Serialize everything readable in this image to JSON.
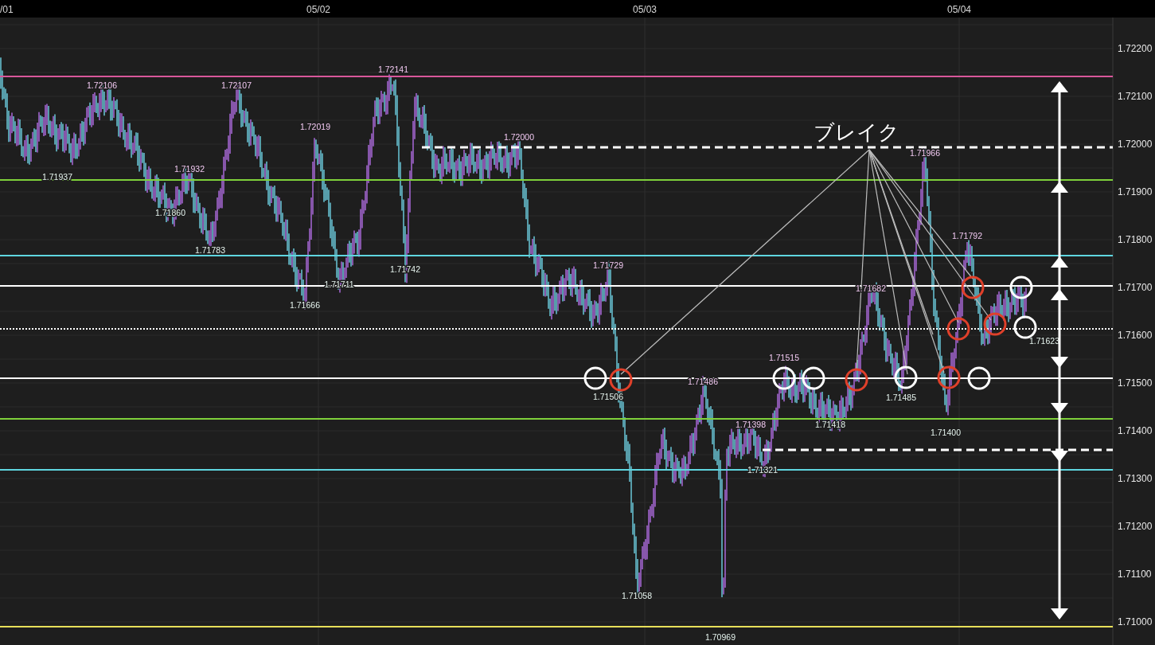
{
  "date_labels": [
    "/01",
    "05/02",
    "05/03",
    "05/04"
  ],
  "price_axis": [
    "1.72200",
    "1.72100",
    "1.72000",
    "1.71900",
    "1.71800",
    "1.71700",
    "1.71600",
    "1.71500",
    "1.71400",
    "1.71300",
    "1.71200",
    "1.71100",
    "1.71000"
  ],
  "level_lines": [
    {
      "kind": "solid",
      "color": "#d9579b"
    },
    {
      "kind": "solid",
      "color": "#7fd13b"
    },
    {
      "kind": "solid",
      "color": "#5fd6e0"
    },
    {
      "kind": "solid",
      "color": "#ffffff"
    },
    {
      "kind": "dotted",
      "color": "#ffffff"
    },
    {
      "kind": "solid",
      "color": "#ffffff"
    },
    {
      "kind": "solid",
      "color": "#7fd13b"
    },
    {
      "kind": "solid",
      "color": "#5fd6e0"
    },
    {
      "kind": "solid",
      "color": "#e8e05a"
    },
    {
      "kind": "dashed",
      "color": "#ffffff"
    },
    {
      "kind": "dashed",
      "color": "#ffffff"
    }
  ],
  "price_labels": [
    {
      "text": "1.72106",
      "kind": "high"
    },
    {
      "text": "1.71937",
      "kind": "low"
    },
    {
      "text": "1.71932",
      "kind": "high"
    },
    {
      "text": "1.71860",
      "kind": "low"
    },
    {
      "text": "1.72107",
      "kind": "high"
    },
    {
      "text": "1.71783",
      "kind": "low"
    },
    {
      "text": "1.72019",
      "kind": "high"
    },
    {
      "text": "1.71666",
      "kind": "low"
    },
    {
      "text": "1.71711",
      "kind": "low"
    },
    {
      "text": "1.72141",
      "kind": "high"
    },
    {
      "text": "1.71742",
      "kind": "low"
    },
    {
      "text": "1.72000",
      "kind": "high"
    },
    {
      "text": "1.71729",
      "kind": "high"
    },
    {
      "text": "1.71506",
      "kind": "low"
    },
    {
      "text": "1.71486",
      "kind": "high"
    },
    {
      "text": "1.71058",
      "kind": "low"
    },
    {
      "text": "1.70969",
      "kind": "low"
    },
    {
      "text": "1.71398",
      "kind": "high"
    },
    {
      "text": "1.71321",
      "kind": "low"
    },
    {
      "text": "1.71515",
      "kind": "high"
    },
    {
      "text": "1.71418",
      "kind": "low"
    },
    {
      "text": "1.71682",
      "kind": "high"
    },
    {
      "text": "1.71485",
      "kind": "low"
    },
    {
      "text": "1.71966",
      "kind": "high"
    },
    {
      "text": "1.71792",
      "kind": "high"
    },
    {
      "text": "1.71400",
      "kind": "low"
    },
    {
      "text": "1.71623",
      "kind": "low"
    }
  ],
  "markers": [
    {
      "color": "#ffffff"
    },
    {
      "color": "#e0402a"
    },
    {
      "color": "#ffffff"
    },
    {
      "color": "#ffffff"
    },
    {
      "color": "#e0402a"
    },
    {
      "color": "#ffffff"
    },
    {
      "color": "#e0402a"
    },
    {
      "color": "#ffffff"
    },
    {
      "color": "#e0402a"
    },
    {
      "color": "#e0402a"
    },
    {
      "color": "#e0402a"
    },
    {
      "color": "#ffffff"
    },
    {
      "color": "#ffffff"
    }
  ],
  "annotation": {
    "text": "ブレイク"
  }
}
